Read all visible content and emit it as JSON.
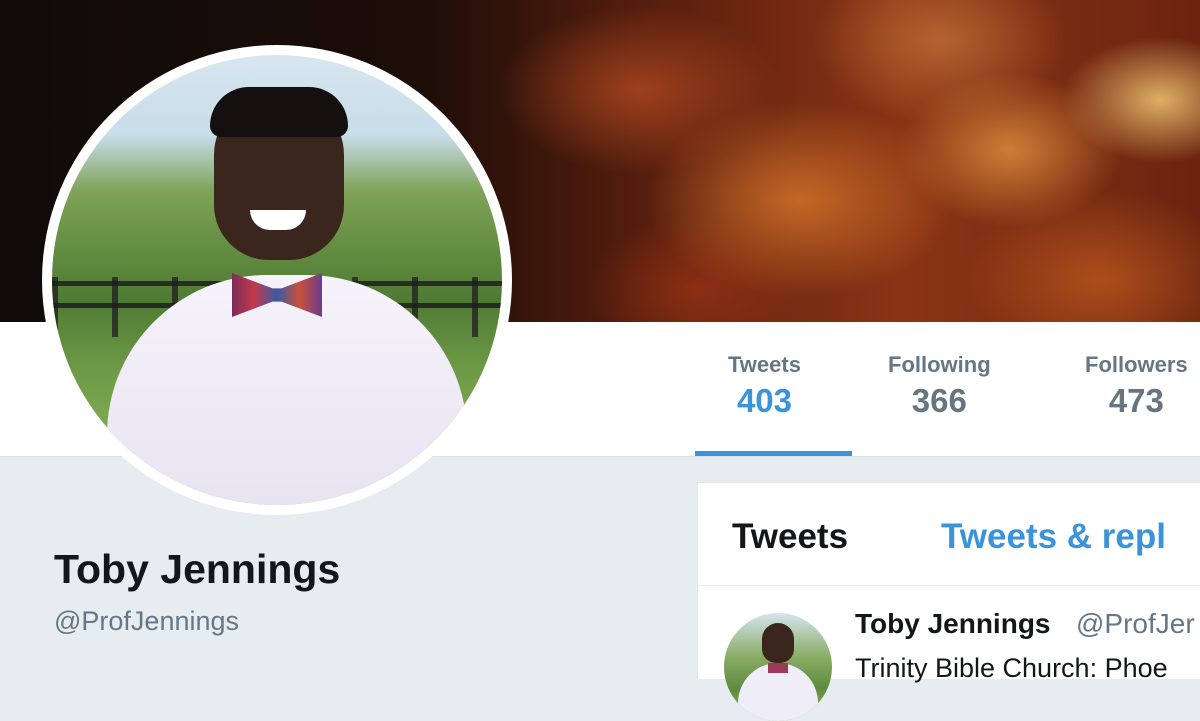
{
  "profile": {
    "name": "Toby Jennings",
    "handle": "@ProfJennings"
  },
  "stats": [
    {
      "label": "Tweets",
      "value": "403"
    },
    {
      "label": "Following",
      "value": "366"
    },
    {
      "label": "Followers",
      "value": "473"
    }
  ],
  "timeline": {
    "tabs": [
      {
        "label": "Tweets"
      },
      {
        "label": "Tweets & repl"
      }
    ],
    "tweet": {
      "author_name": "Toby Jennings",
      "author_handle": "@ProfJer",
      "text": "Trinity Bible Church: Phoe"
    }
  },
  "colors": {
    "accent": "#3b94d9",
    "background": "#e6ecf0",
    "text_primary": "#14171a",
    "text_secondary": "#657786"
  }
}
